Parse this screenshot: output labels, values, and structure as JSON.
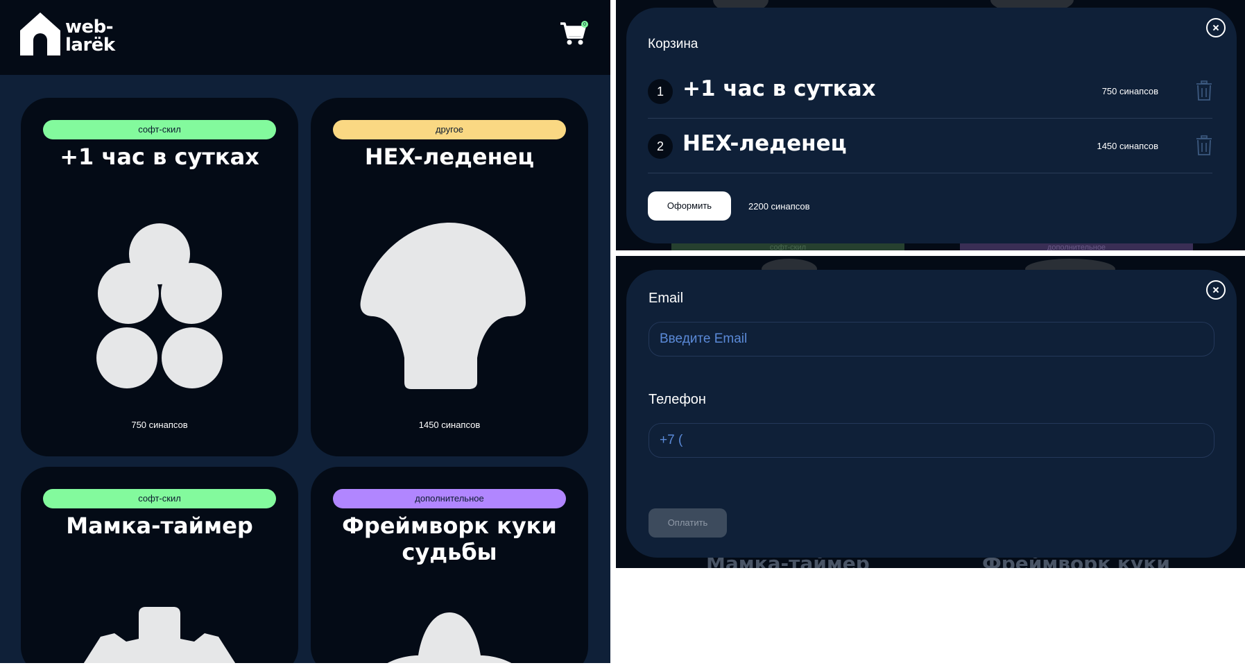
{
  "header": {
    "logo_line1": "web-",
    "logo_line2": "larёk",
    "cart_count": "0"
  },
  "catalog": {
    "cards": [
      {
        "category": "софт-скил",
        "category_color": "#83fa9d",
        "title": "+1 час в сутках",
        "image": "five-circles-icon",
        "price": "750 синапсов"
      },
      {
        "category": "другое",
        "category_color": "#fad883",
        "title": "HEX-леденец",
        "image": "mushroom-shape-icon",
        "price": "1450 синапсов"
      },
      {
        "category": "софт-скил",
        "category_color": "#83fa9d",
        "title": "Мамка-таймер",
        "image": "gear-shape-icon",
        "price": ""
      },
      {
        "category": "дополнительное",
        "category_color": "#b186ff",
        "title": "Фреймворк куки судьбы",
        "image": "cookie-shape-icon",
        "price": ""
      }
    ]
  },
  "basket": {
    "title": "Корзина",
    "items": [
      {
        "index": "1",
        "title": "+1 час в сутках",
        "price": "750 синапсов"
      },
      {
        "index": "2",
        "title": "HEX-леденец",
        "price": "1450 синапсов"
      }
    ],
    "order_button": "Оформить",
    "total": "2200 синапсов",
    "background_peek": {
      "category_left": "софт-скил",
      "category_right": "дополнительное"
    }
  },
  "contacts": {
    "email_label": "Email",
    "email_placeholder": "Введите Email",
    "phone_label": "Телефон",
    "phone_value": "+7 (",
    "pay_button": "Оплатить",
    "background_peek": {
      "title_left": "Мамка-таймер",
      "title_right": "Фреймворк куки"
    }
  },
  "colors": {
    "page_bg": "#0f2038",
    "card_bg": "#040b16",
    "soft_skill": "#83fa9d",
    "other": "#fad883",
    "additional": "#b186ff",
    "placeholder": "#5b8ad8"
  }
}
